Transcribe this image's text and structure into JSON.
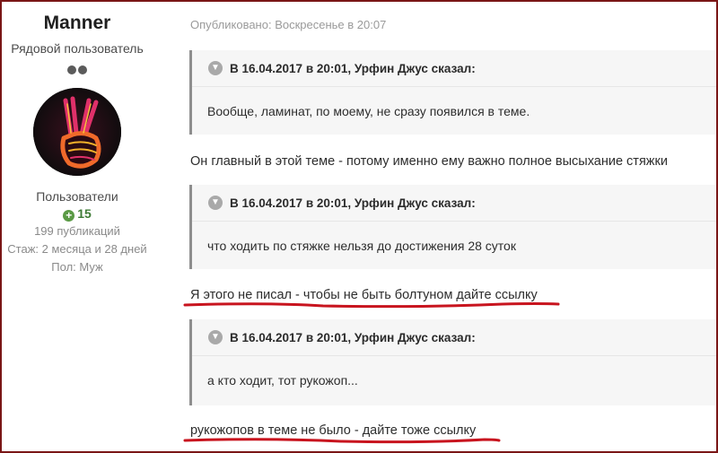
{
  "author": {
    "name": "Manner",
    "title": "Рядовой пользователь",
    "group": "Пользователи",
    "reputation": "15",
    "posts": "199 публикаций",
    "since": "Стаж: 2 месяца и 28 дней",
    "gender": "Пол: Муж",
    "rank_icon": "two-dots-rank-icon",
    "avatar_icon": "v-sign-hand-avatar"
  },
  "post": {
    "date": "Опубликовано: Воскресенье в 20:07",
    "blocks": [
      {
        "quote_header": "В 16.04.2017 в 20:01, Урфин Джус сказал:",
        "quote_text": "Вообще, ламинат, по моему, не сразу появился в теме.",
        "reply": "Он главный в этой теме - потому именно ему важно полное высыхание стяжки"
      },
      {
        "quote_header": "В 16.04.2017 в 20:01, Урфин Джус сказал:",
        "quote_text": "что ходить по стяжке нельзя до достижения 28 суток",
        "reply": "Я этого не писал - чтобы не быть болтуном дайте ссылку"
      },
      {
        "quote_header": "В 16.04.2017 в 20:01, Урфин Джус сказал:",
        "quote_text": "а кто ходит, тот рукожоп...",
        "reply": "рукожопов в теме не было - дайте тоже ссылку"
      }
    ]
  },
  "colors": {
    "frame": "#7a1616",
    "underline": "#c8141e",
    "reputation": "#3e7b36",
    "quote_bg": "#f6f6f6"
  }
}
